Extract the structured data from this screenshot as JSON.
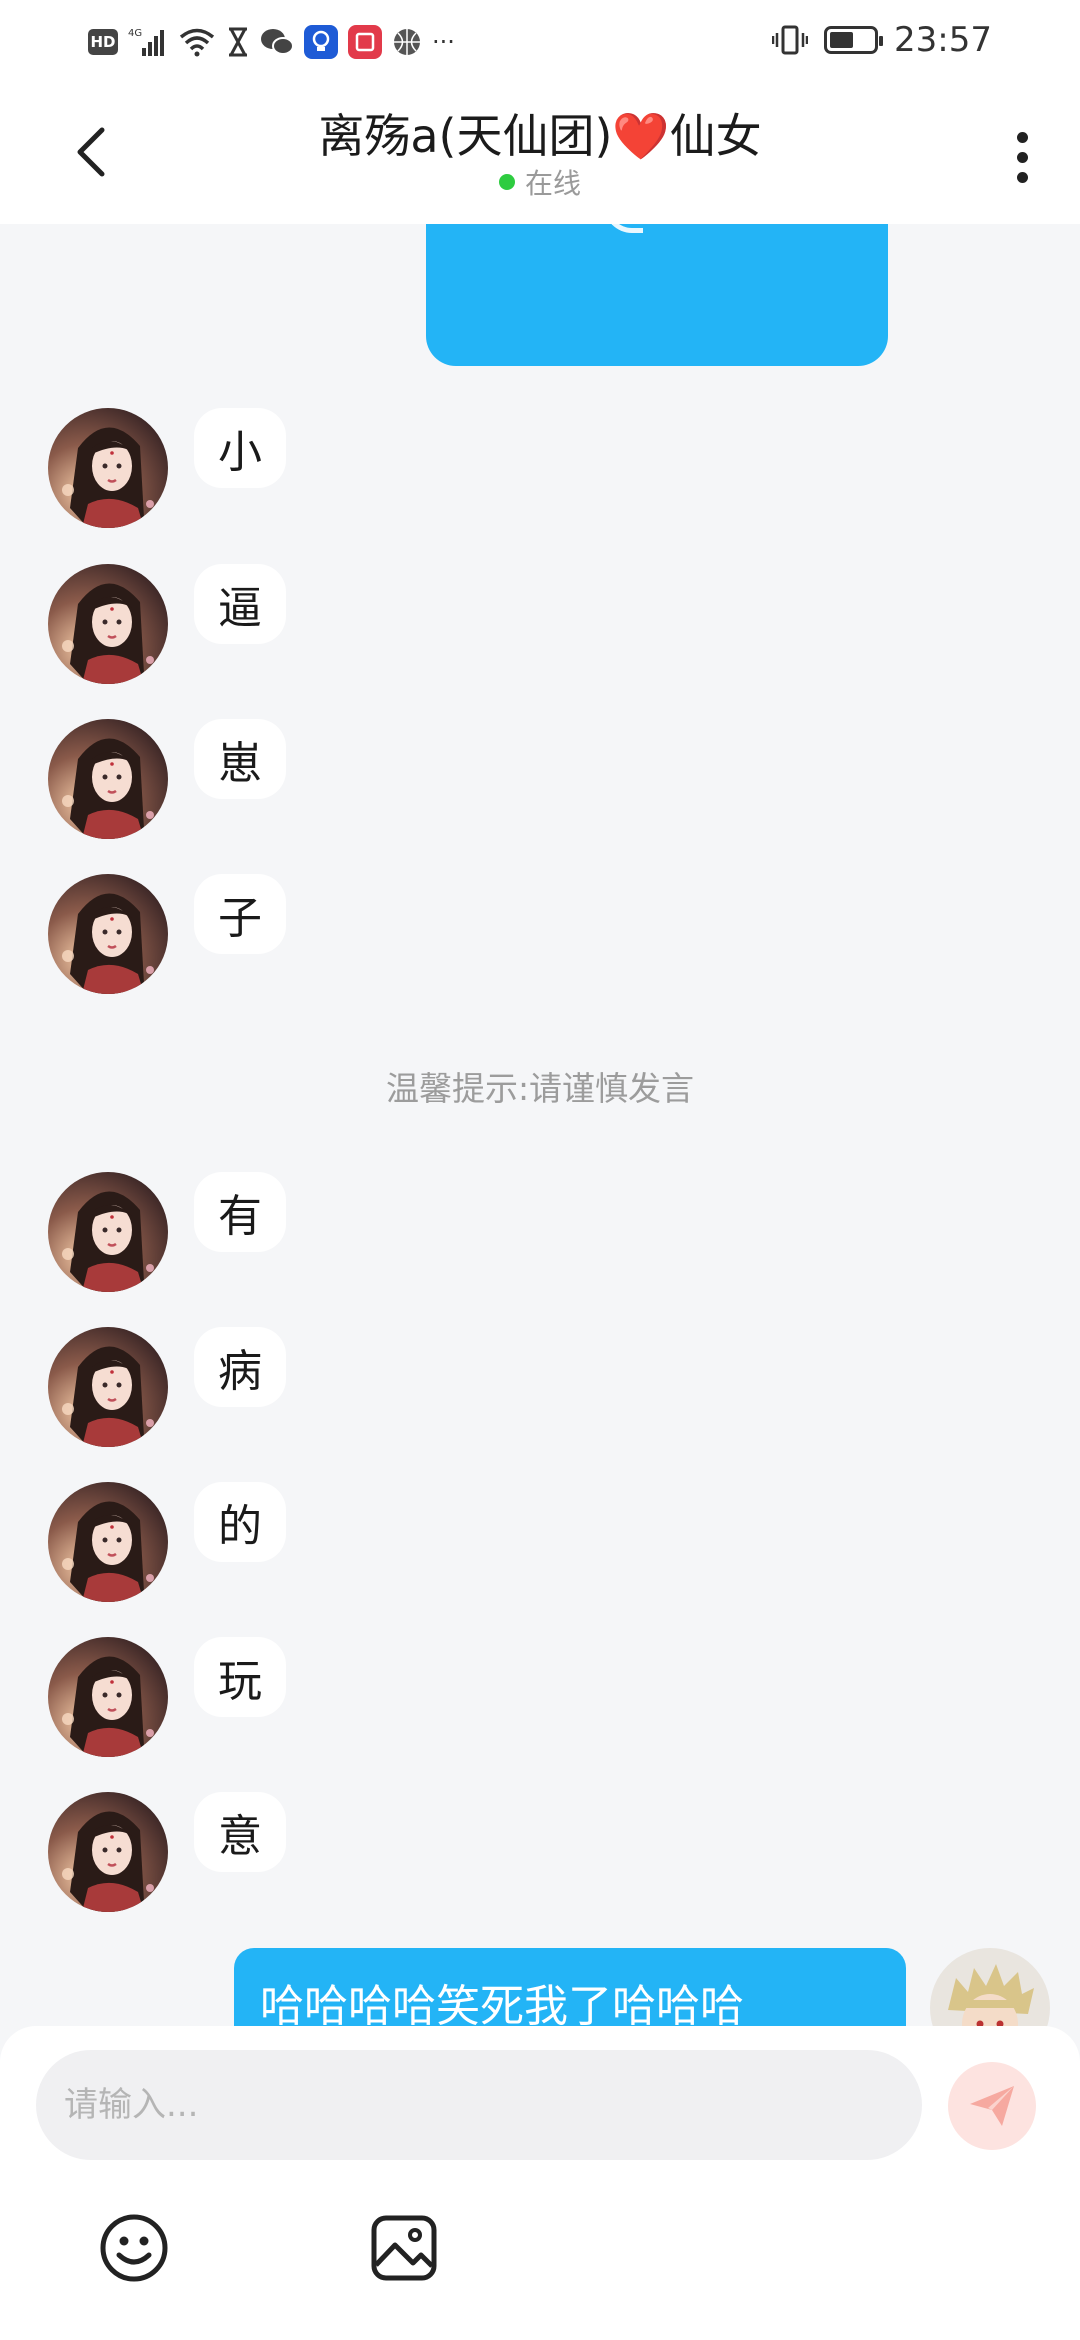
{
  "status_bar": {
    "hd": "HD",
    "network": "4G",
    "time": "23:57",
    "battery_level": 0.55,
    "more": "···"
  },
  "header": {
    "title": "离殇a(天仙团)❤️仙女",
    "status": "在线"
  },
  "messages_left": [
    "小",
    "逼",
    "崽",
    "子",
    "有",
    "病",
    "的",
    "玩",
    "意"
  ],
  "notice": "温馨提示:请谨慎发言",
  "message_right": "哈哈哈哈笑死我了哈哈哈",
  "composer": {
    "placeholder": "请输入..."
  },
  "colors": {
    "accent_blue": "#23b4f6",
    "online_green": "#2ecc40",
    "send_button": "#fde3e0"
  },
  "icons": [
    "back-arrow-icon",
    "more-vertical-icon",
    "send-icon",
    "emoji-icon",
    "image-icon"
  ]
}
